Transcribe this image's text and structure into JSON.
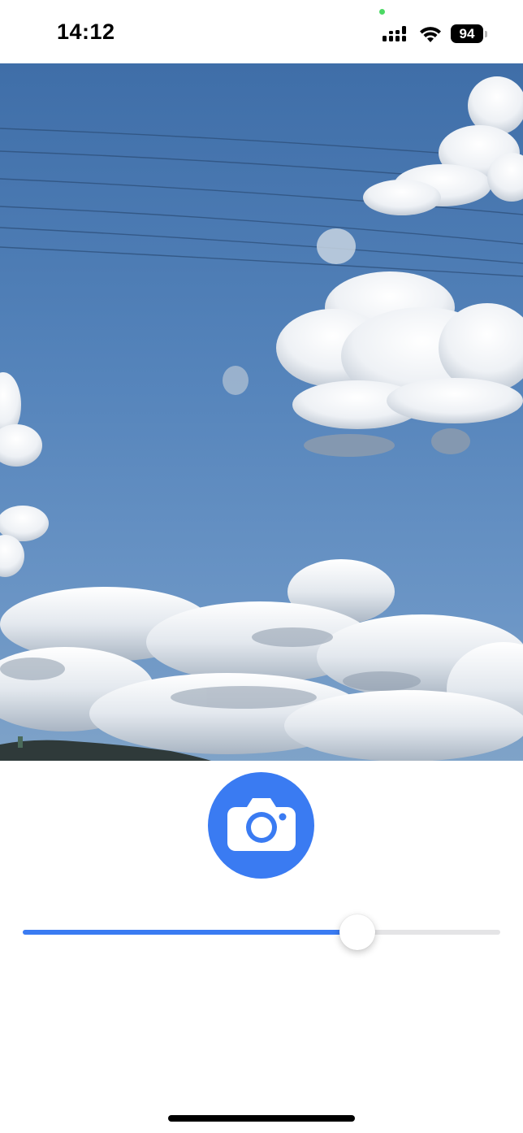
{
  "status_bar": {
    "time": "14:12",
    "battery_level": "94",
    "icons": [
      "signal-icon",
      "wifi-icon",
      "battery-icon"
    ]
  },
  "camera": {
    "preview_content": "sky-with-clouds"
  },
  "shutter": {
    "icon": "camera-icon",
    "color": "#3a7bf2"
  },
  "zoom": {
    "value": 0.71,
    "accent_color": "#3a7bf2",
    "track_color": "#e4e4e6"
  }
}
